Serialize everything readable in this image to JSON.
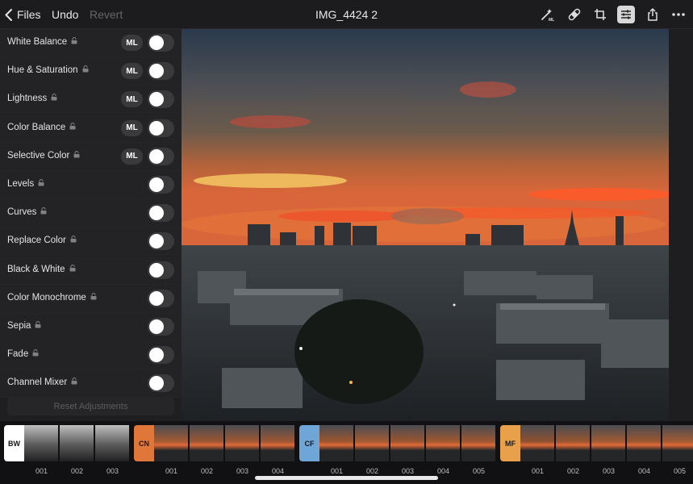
{
  "topbar": {
    "back_label": "Files",
    "undo_label": "Undo",
    "revert_label": "Revert",
    "title": "IMG_4424 2"
  },
  "adjustments": [
    {
      "label": "White Balance",
      "ml": "ML",
      "enabled": false
    },
    {
      "label": "Hue & Saturation",
      "ml": "ML",
      "enabled": false
    },
    {
      "label": "Lightness",
      "ml": "ML",
      "enabled": false
    },
    {
      "label": "Color Balance",
      "ml": "ML",
      "enabled": false
    },
    {
      "label": "Selective Color",
      "ml": "ML",
      "enabled": false
    },
    {
      "label": "Levels",
      "ml": null,
      "enabled": false
    },
    {
      "label": "Curves",
      "ml": null,
      "enabled": false
    },
    {
      "label": "Replace Color",
      "ml": null,
      "enabled": false
    },
    {
      "label": "Black & White",
      "ml": null,
      "enabled": false
    },
    {
      "label": "Color Monochrome",
      "ml": null,
      "enabled": false
    },
    {
      "label": "Sepia",
      "ml": null,
      "enabled": false
    },
    {
      "label": "Fade",
      "ml": null,
      "enabled": false
    },
    {
      "label": "Channel Mixer",
      "ml": null,
      "enabled": false
    }
  ],
  "reset_label": "Reset Adjustments",
  "filters": [
    {
      "code": "BW",
      "color": "#ffffff",
      "text_color": "#111111",
      "items": [
        "001",
        "002",
        "003"
      ]
    },
    {
      "code": "CN",
      "color": "#e0773a",
      "text_color": "#1a1a1a",
      "items": [
        "001",
        "002",
        "003",
        "004"
      ]
    },
    {
      "code": "CF",
      "color": "#6fa6d8",
      "text_color": "#1a1a1a",
      "items": [
        "001",
        "002",
        "003",
        "004",
        "005"
      ]
    },
    {
      "code": "MF",
      "color": "#e9a04a",
      "text_color": "#1a1a1a",
      "items": [
        "001",
        "002",
        "003",
        "004",
        "005"
      ]
    }
  ],
  "icons": {
    "auto": "magic-wand-ml-icon",
    "heal": "bandage-icon",
    "crop": "crop-icon",
    "adjust": "sliders-icon",
    "share": "share-icon",
    "more": "ellipsis-icon",
    "lock": "lock-icon"
  }
}
